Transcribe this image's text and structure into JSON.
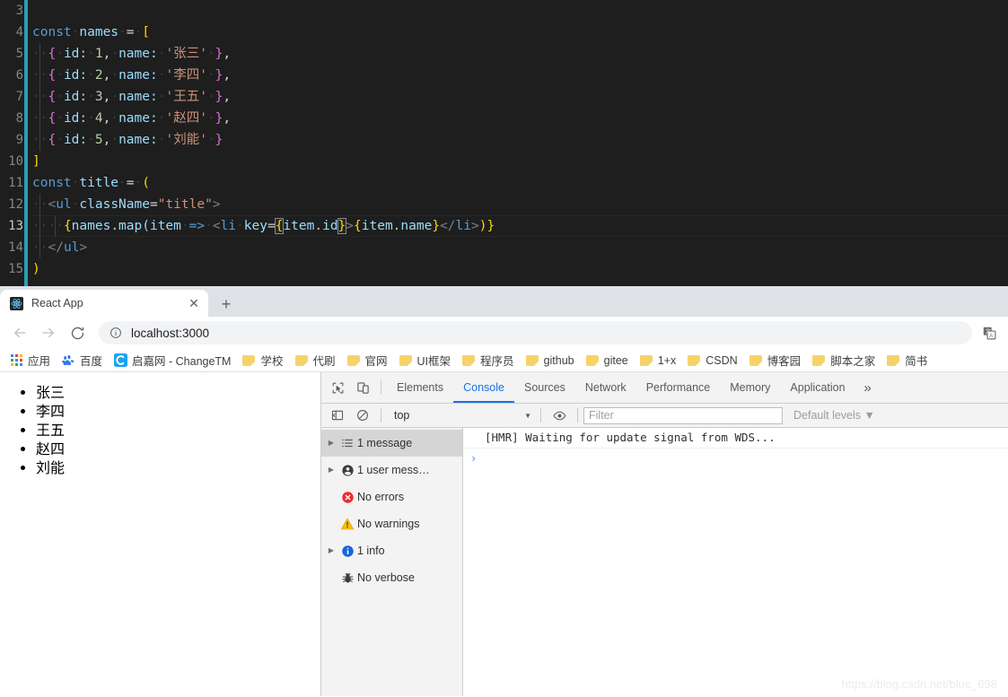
{
  "editor": {
    "theme_bg": "#1e1e1e",
    "lines": [
      {
        "num": "3",
        "active": false
      },
      {
        "num": "4",
        "active": false
      },
      {
        "num": "5",
        "active": false
      },
      {
        "num": "6",
        "active": false
      },
      {
        "num": "7",
        "active": false
      },
      {
        "num": "8",
        "active": false
      },
      {
        "num": "9",
        "active": false
      },
      {
        "num": "10",
        "active": false
      },
      {
        "num": "11",
        "active": false
      },
      {
        "num": "12",
        "active": false
      },
      {
        "num": "13",
        "active": true
      },
      {
        "num": "14",
        "active": false
      },
      {
        "num": "15",
        "active": false
      }
    ],
    "code": {
      "l3": "",
      "l4_kw": "const",
      "l4_name": "names",
      "l4_eq": "=",
      "l4_br": "[",
      "l5_key": "id:",
      "l5_id": "1",
      "l5_namekey": "name:",
      "l5_val": "'张三'",
      "l6_id": "2",
      "l6_val": "'李四'",
      "l7_id": "3",
      "l7_val": "'王五'",
      "l8_id": "4",
      "l8_val": "'赵四'",
      "l9_id": "5",
      "l9_val": "'刘能'",
      "l10": "]",
      "l11_kw": "const",
      "l11_name": "title",
      "l12_tag": "ul",
      "l12_attr": "className",
      "l12_attrval": "\"title\"",
      "l13_expr": "names.map(item",
      "l13_arrow": "=>",
      "l13_li": "li",
      "l13_key": "key",
      "l13_itemid": "item.id",
      "l13_itemname": "item.name",
      "l14": "</ul>",
      "l15": ")"
    }
  },
  "browser": {
    "tab": {
      "title": "React App",
      "favicon": "react-icon",
      "close_label": "✕"
    },
    "new_tab_label": "+",
    "nav": {
      "back": "←",
      "forward": "→",
      "reload": "⟳"
    },
    "omnibox": {
      "info_icon": "info-circle-icon",
      "url": "localhost:3000"
    },
    "translate_icon": "translate-icon",
    "bookmarks": [
      {
        "label": "应用",
        "icon": "apps-grid-icon"
      },
      {
        "label": "百度",
        "icon": "baidu-icon"
      },
      {
        "label": "启嘉网 - ChangeTM",
        "icon": "changetm-icon"
      },
      {
        "label": "学校",
        "icon": "folder-icon"
      },
      {
        "label": "代刷",
        "icon": "folder-icon"
      },
      {
        "label": "官网",
        "icon": "folder-icon"
      },
      {
        "label": "UI框架",
        "icon": "folder-icon"
      },
      {
        "label": "程序员",
        "icon": "folder-icon"
      },
      {
        "label": "github",
        "icon": "folder-icon"
      },
      {
        "label": "gitee",
        "icon": "folder-icon"
      },
      {
        "label": "1+x",
        "icon": "folder-icon"
      },
      {
        "label": "CSDN",
        "icon": "folder-icon"
      },
      {
        "label": "博客园",
        "icon": "folder-icon"
      },
      {
        "label": "脚本之家",
        "icon": "folder-icon"
      },
      {
        "label": "简书",
        "icon": "folder-icon"
      }
    ]
  },
  "page": {
    "list_items": [
      "张三",
      "李四",
      "王五",
      "赵四",
      "刘能"
    ]
  },
  "devtools": {
    "accent_color": "#1a73e8",
    "toolbar_icons": [
      {
        "name": "inspect-element-icon"
      },
      {
        "name": "device-toolbar-icon"
      }
    ],
    "tabs": [
      {
        "label": "Elements",
        "selected": false
      },
      {
        "label": "Console",
        "selected": true
      },
      {
        "label": "Sources",
        "selected": false
      },
      {
        "label": "Network",
        "selected": false
      },
      {
        "label": "Performance",
        "selected": false
      },
      {
        "label": "Memory",
        "selected": false
      },
      {
        "label": "Application",
        "selected": false
      }
    ],
    "more_tabs_label": "»",
    "filterbar": {
      "sidebar_toggle_icon": "console-sidebar-toggle-icon",
      "clear_icon": "clear-console-icon",
      "context": "top",
      "context_caret": "▼",
      "eye_icon": "live-expression-icon",
      "filter_value": "",
      "filter_placeholder": "Filter",
      "levels_label": "Default levels ▼"
    },
    "sidebar": [
      {
        "label": "1 message",
        "icon": "list-icon",
        "arrow": true,
        "selected": true
      },
      {
        "label": "1 user mess…",
        "icon": "person-icon",
        "arrow": true,
        "selected": false
      },
      {
        "label": "No errors",
        "icon": "error-icon",
        "arrow": false,
        "selected": false
      },
      {
        "label": "No warnings",
        "icon": "warning-icon",
        "arrow": false,
        "selected": false
      },
      {
        "label": "1 info",
        "icon": "info-icon",
        "arrow": true,
        "selected": false
      },
      {
        "label": "No verbose",
        "icon": "bug-icon",
        "arrow": false,
        "selected": false
      }
    ],
    "console": {
      "message": "[HMR] Waiting for update signal from WDS...",
      "prompt_caret": "›"
    }
  },
  "watermark": "https://blog.csdn.net/blue_698"
}
